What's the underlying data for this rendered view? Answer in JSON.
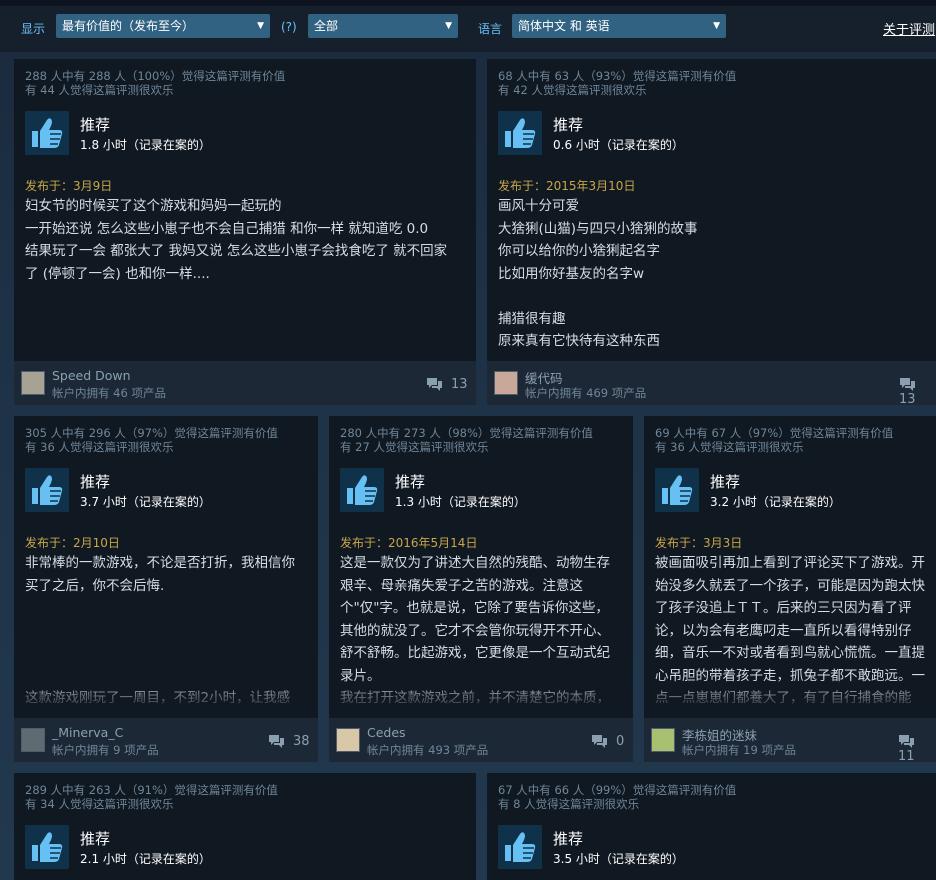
{
  "filters": {
    "display_label": "显示",
    "sort_value": "最有价值的（发布至今）",
    "help_label": "(?)",
    "type_value": "全部",
    "language_label": "语言",
    "language_value": "简体中文 和 英语",
    "about_link": "关于评测"
  },
  "colors": {
    "accent": "#67c1f5",
    "select_bg": "#316282",
    "posted": "#c8a64a",
    "card_bg": "#101822"
  },
  "reviews": [
    {
      "helpful": "288 人中有 288 人（100%）觉得这篇评测有价值",
      "funny": "有 44 人觉得这篇评测很欢乐",
      "verdict": "推荐",
      "hours": "1.8 小时（记录在案的）",
      "posted": "发布于：3月9日",
      "lines": [
        "妇女节的时候买了这个游戏和妈妈一起玩的",
        "一开始还说 怎么这些小崽子也不会自己捕猎 和你一样 就知道吃 0.0",
        "结果玩了一会 都张大了 我妈又说 怎么这些小崽子会找食吃了 就不回家",
        "了 (停顿了一会) 也和你一样...."
      ],
      "author": "Speed Down",
      "products": "帐户内拥有 46 项产品",
      "comments": "13"
    },
    {
      "helpful": "68 人中有 63 人（93%）觉得这篇评测有价值",
      "funny": "有 42 人觉得这篇评测很欢乐",
      "verdict": "推荐",
      "hours": "0.6 小时（记录在案的）",
      "posted": "发布于：2015年3月10日",
      "lines": [
        "画风十分可爱",
        "大猞猁(山猫)与四只小猞猁的故事",
        "你可以给你的小猞猁起名字",
        "比如用你好基友的名字w",
        "",
        "捕猎很有趣",
        "原来真有它快待有这种东西"
      ],
      "author": "缓代码",
      "products": "帐户内拥有 469 项产品",
      "comments": "13"
    },
    {
      "helpful": "305 人中有 296 人（97%）觉得这篇评测有价值",
      "funny": "有 36 人觉得这篇评测很欢乐",
      "verdict": "推荐",
      "hours": "3.7 小时（记录在案的）",
      "posted": "发布于：2月10日",
      "lines": [
        "非常棒的一款游戏，不论是否打折，我相信你",
        "买了之后，你不会后悔.",
        "",
        "",
        "",
        "",
        "这款游戏刚玩了一周目，不到2小时，让我感"
      ],
      "author": "_Minerva_C",
      "products": "帐户内拥有 9 项产品",
      "comments": "38"
    },
    {
      "helpful": "280 人中有 273 人（98%）觉得这篇评测有价值",
      "funny": "有 27 人觉得这篇评测很欢乐",
      "verdict": "推荐",
      "hours": "1.3 小时（记录在案的）",
      "posted": "发布于：2016年5月14日",
      "lines": [
        "这是一款仅为了讲述大自然的残酷、动物生存",
        "艰辛、母亲痛失爱子之苦的游戏。注意这",
        "个\"仅\"字。也就是说，它除了要告诉你这些，",
        "其他的就没了。它才不会管你玩得开不开心、",
        "舒不舒畅。比起游戏，它更像是一个互动式纪",
        "录片。",
        "我在打开这款游戏之前，并不清楚它的本质，"
      ],
      "author": "Cedes",
      "products": "帐户内拥有 493 项产品",
      "comments": "0"
    },
    {
      "helpful": "69 人中有 67 人（97%）觉得这篇评测有价值",
      "funny": "有 36 人觉得这篇评测很欢乐",
      "verdict": "推荐",
      "hours": "3.2 小时（记录在案的）",
      "posted": "发布于：3月3日",
      "lines": [
        "被画面吸引再加上看到了评论买下了游戏。开",
        "始没多久就丢了一个孩子，可能是因为跑太快",
        "了孩子没追上ＴＴ。后来的三只因为看了评",
        "论，以为会有老鹰叼走一直所以看得特别仔",
        "细，音乐一不对或者看到鸟就心慌慌。一直提",
        "心吊胆的带着孩子走，抓兔子都不敢跑远。一",
        "点一点崽崽们都養大了，有了自行捕食的能"
      ],
      "author": "李栋姐的迷妹",
      "products": "帐户内拥有 19 项产品",
      "comments": "11"
    },
    {
      "helpful": "289 人中有 263 人（91%）觉得这篇评测有价值",
      "funny": "有 34 人觉得这篇评测很欢乐",
      "verdict": "推荐",
      "hours": "2.1 小时（记录在案的）"
    },
    {
      "helpful": "67 人中有 66 人（99%）觉得这篇评测有价值",
      "funny": "有 8 人觉得这篇评测很欢乐",
      "verdict": "推荐",
      "hours": "3.5 小时（记录在案的）"
    }
  ]
}
